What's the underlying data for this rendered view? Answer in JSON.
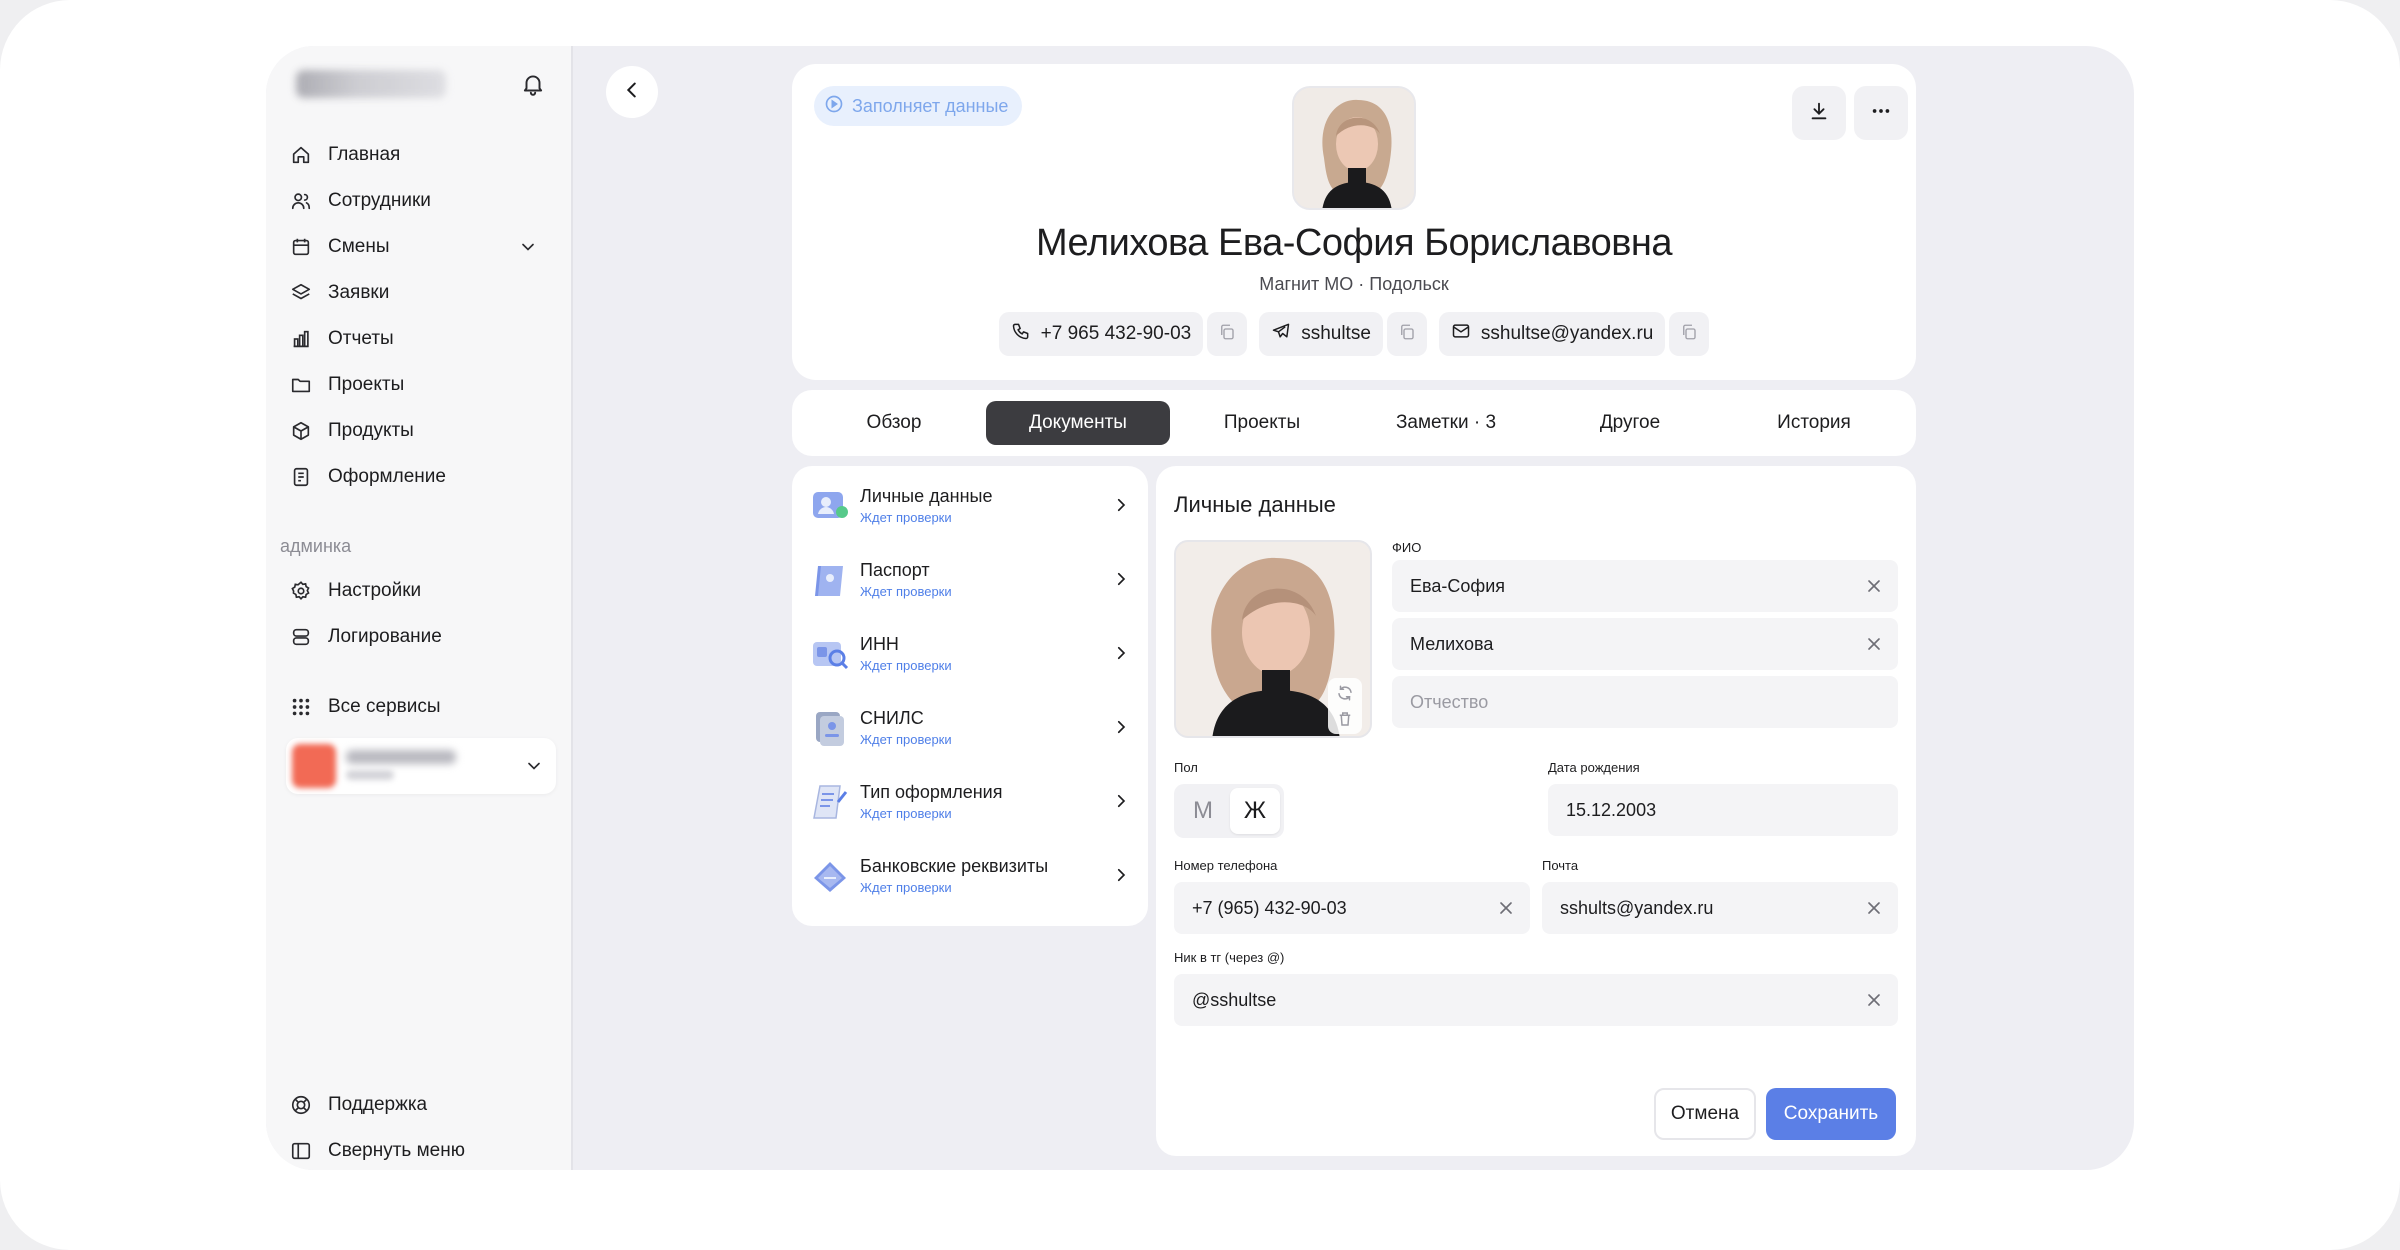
{
  "sidebar": {
    "nav": [
      {
        "label": "Главная",
        "icon": "home-icon"
      },
      {
        "label": "Сотрудники",
        "icon": "users-icon"
      },
      {
        "label": "Смены",
        "icon": "calendar-icon"
      },
      {
        "label": "Заявки",
        "icon": "layers-icon"
      },
      {
        "label": "Отчеты",
        "icon": "bar-chart-icon"
      },
      {
        "label": "Проекты",
        "icon": "folder-icon"
      },
      {
        "label": "Продукты",
        "icon": "box-icon"
      },
      {
        "label": "Оформление",
        "icon": "document-icon"
      }
    ],
    "section_label": "админка",
    "admin": [
      {
        "label": "Настройки",
        "icon": "gear-icon"
      },
      {
        "label": "Логирование",
        "icon": "database-icon"
      }
    ],
    "all_services": "Все сервисы",
    "footer": [
      {
        "label": "Поддержка",
        "icon": "lifebuoy-icon"
      },
      {
        "label": "Свернуть меню",
        "icon": "sidebar-icon"
      }
    ]
  },
  "profile": {
    "status": "Заполняет данные",
    "name": "Мелихова Ева-София Бориславовна",
    "subtitle": "Магнит МО · Подольск",
    "phone": "+7 965 432-90-03",
    "telegram": "sshultse",
    "email": "sshultse@yandex.ru"
  },
  "tabs": [
    "Обзор",
    "Документы",
    "Проекты",
    "Заметки · 3",
    "Другое",
    "История"
  ],
  "documents": [
    {
      "title": "Личные данные",
      "status": "Ждет проверки"
    },
    {
      "title": "Паспорт",
      "status": "Ждет проверки"
    },
    {
      "title": "ИНН",
      "status": "Ждет проверки"
    },
    {
      "title": "СНИЛС",
      "status": "Ждет проверки"
    },
    {
      "title": "Тип оформления",
      "status": "Ждет проверки"
    },
    {
      "title": "Банковские реквизиты",
      "status": "Ждет проверки"
    }
  ],
  "form": {
    "title": "Личные данные",
    "fio_label": "ФИО",
    "first_name": "Ева-София",
    "last_name": "Мелихова",
    "patronymic_placeholder": "Отчество",
    "gender_label": "Пол",
    "gender_m": "М",
    "gender_f": "Ж",
    "birth_label": "Дата рождения",
    "birth_date": "15.12.2003",
    "phone_label": "Номер телефона",
    "phone": "+7 (965) 432-90-03",
    "email_label": "Почта",
    "email": "sshults@yandex.ru",
    "tg_label": "Ник в тг (через @)",
    "tg": "@sshultse",
    "cancel": "Отмена",
    "save": "Сохранить"
  },
  "colors": {
    "accent": "#5b7fe6",
    "tab_active": "#3c3c40",
    "status_text": "#4f7fe8"
  }
}
